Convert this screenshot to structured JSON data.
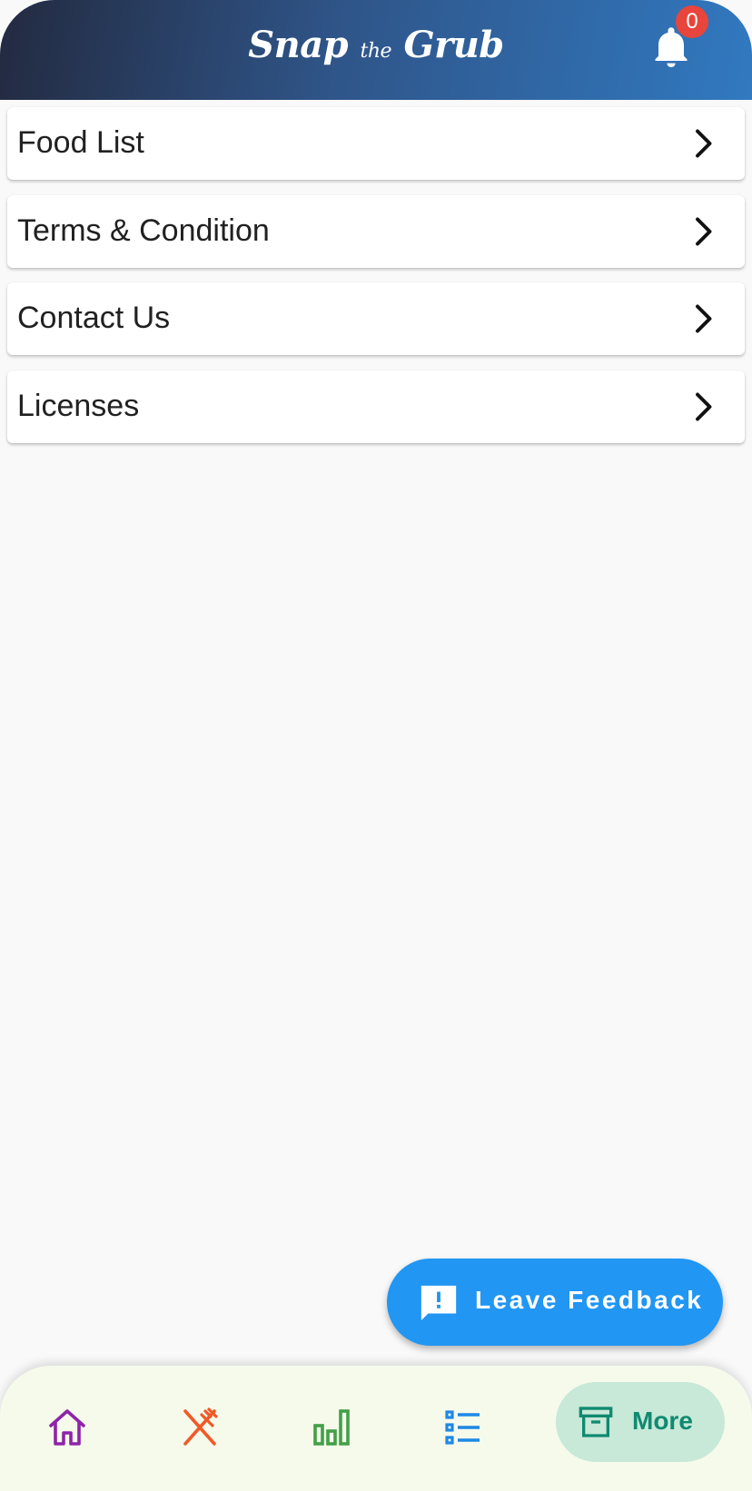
{
  "header": {
    "title_part1": "Snap",
    "title_small": "the",
    "title_part2": "Grub",
    "notification_count": "0",
    "bell_icon": "bell-icon"
  },
  "menu": {
    "items": [
      {
        "label": "Food List",
        "icon": "chevron-right-icon"
      },
      {
        "label": "Terms & Condition",
        "icon": "chevron-right-icon"
      },
      {
        "label": "Contact Us",
        "icon": "chevron-right-icon"
      },
      {
        "label": "Licenses",
        "icon": "chevron-right-icon"
      }
    ]
  },
  "fab": {
    "label": "Leave Feedback",
    "icon": "feedback-icon"
  },
  "bottom_nav": {
    "items": [
      {
        "icon": "home-icon",
        "color": "#8e24aa"
      },
      {
        "icon": "utensils-icon",
        "color": "#f05a28"
      },
      {
        "icon": "bar-chart-icon",
        "color": "#43a047"
      },
      {
        "icon": "list-icon",
        "color": "#1e88e5"
      },
      {
        "icon": "archive-icon",
        "label": "More",
        "color": "#0f8a70",
        "selected": true
      }
    ]
  },
  "colors": {
    "header_gradient_start": "#232a40",
    "header_gradient_end": "#3179c0",
    "fab_background": "#2196f3",
    "badge": "#e8453c"
  }
}
